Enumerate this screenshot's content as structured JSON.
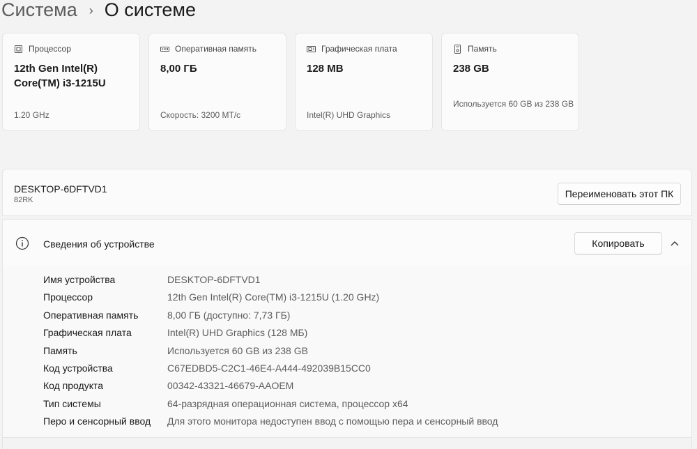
{
  "breadcrumb": {
    "parent": "Система",
    "separator": "›",
    "current": "О системе"
  },
  "cards": [
    {
      "icon": "processor-icon",
      "label": "Процессор",
      "value": "12th Gen Intel(R) Core(TM) i3-1215U",
      "sub": "1.20 GHz"
    },
    {
      "icon": "memory-icon",
      "label": "Оперативная память",
      "value": "8,00 ГБ",
      "sub": "Скорость: 3200 MT/c"
    },
    {
      "icon": "graphics-card-icon",
      "label": "Графическая плата",
      "value": "128 MB",
      "sub": "Intel(R) UHD Graphics"
    },
    {
      "icon": "storage-icon",
      "label": "Память",
      "value": "238 GB",
      "sub": "Используется 60 GB из 238 GB"
    }
  ],
  "pc": {
    "name": "DESKTOP-6DFTVD1",
    "model": "82RK",
    "rename_label": "Переименовать этот ПК"
  },
  "device_details": {
    "title": "Сведения об устройстве",
    "copy_label": "Копировать",
    "rows": [
      {
        "key": "Имя устройства",
        "value": "DESKTOP-6DFTVD1"
      },
      {
        "key": "Процессор",
        "value": "12th Gen Intel(R) Core(TM) i3-1215U (1.20 GHz)"
      },
      {
        "key": "Оперативная память",
        "value": "8,00 ГБ (доступно: 7,73 ГБ)"
      },
      {
        "key": "Графическая плата",
        "value": "Intel(R) UHD Graphics (128 МБ)"
      },
      {
        "key": "Память",
        "value": "Используется 60 GB из 238 GB"
      },
      {
        "key": "Код устройства",
        "value": "C67EDBD5-C2C1-46E4-A444-492039B15CC0"
      },
      {
        "key": "Код продукта",
        "value": "00342-43321-46679-AAOEM"
      },
      {
        "key": "Тип системы",
        "value": "64-разрядная операционная система, процессор x64"
      },
      {
        "key": "Перо и сенсорный ввод",
        "value": "Для этого монитора недоступен ввод с помощью пера и сенсорный ввод"
      }
    ]
  }
}
